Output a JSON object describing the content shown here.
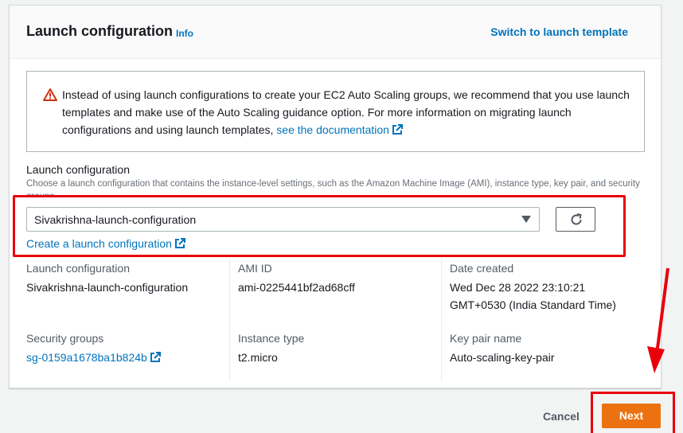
{
  "panel": {
    "title": "Launch configuration",
    "info_label": "Info",
    "switch_label": "Switch to launch template"
  },
  "alert": {
    "text": "Instead of using launch configurations to create your EC2 Auto Scaling groups, we recommend that you use launch templates and make use of the Auto Scaling guidance option. For more information on migrating launch configurations and using launch templates, ",
    "link_label": "see the documentation"
  },
  "field": {
    "label": "Launch configuration",
    "description": "Choose a launch configuration that contains the instance-level settings, such as the Amazon Machine Image (AMI), instance type, key pair, and security groups.",
    "selected_value": "Sivakrishna-launch-configuration",
    "create_link": "Create a launch configuration"
  },
  "details": {
    "launch_config_label": "Launch configuration",
    "launch_config_value": "Sivakrishna-launch-configuration",
    "ami_label": "AMI ID",
    "ami_value": "ami-0225441bf2ad68cff",
    "date_label": "Date created",
    "date_line1": "Wed Dec 28 2022 23:10:21",
    "date_line2": "GMT+0530 (India Standard Time)",
    "sg_label": "Security groups",
    "sg_value": "sg-0159a1678ba1b824b",
    "instance_type_label": "Instance type",
    "instance_type_value": "t2.micro",
    "key_pair_label": "Key pair name",
    "key_pair_value": "Auto-scaling-key-pair"
  },
  "footer": {
    "cancel_label": "Cancel",
    "next_label": "Next"
  },
  "colors": {
    "link": "#0073bb",
    "primary": "#ec7211",
    "annotation": "#e8000b",
    "warning": "#d13212"
  },
  "icons": [
    "warning-icon",
    "external-link-icon",
    "caret-down-icon",
    "refresh-icon",
    "annotation-arrow-icon"
  ]
}
